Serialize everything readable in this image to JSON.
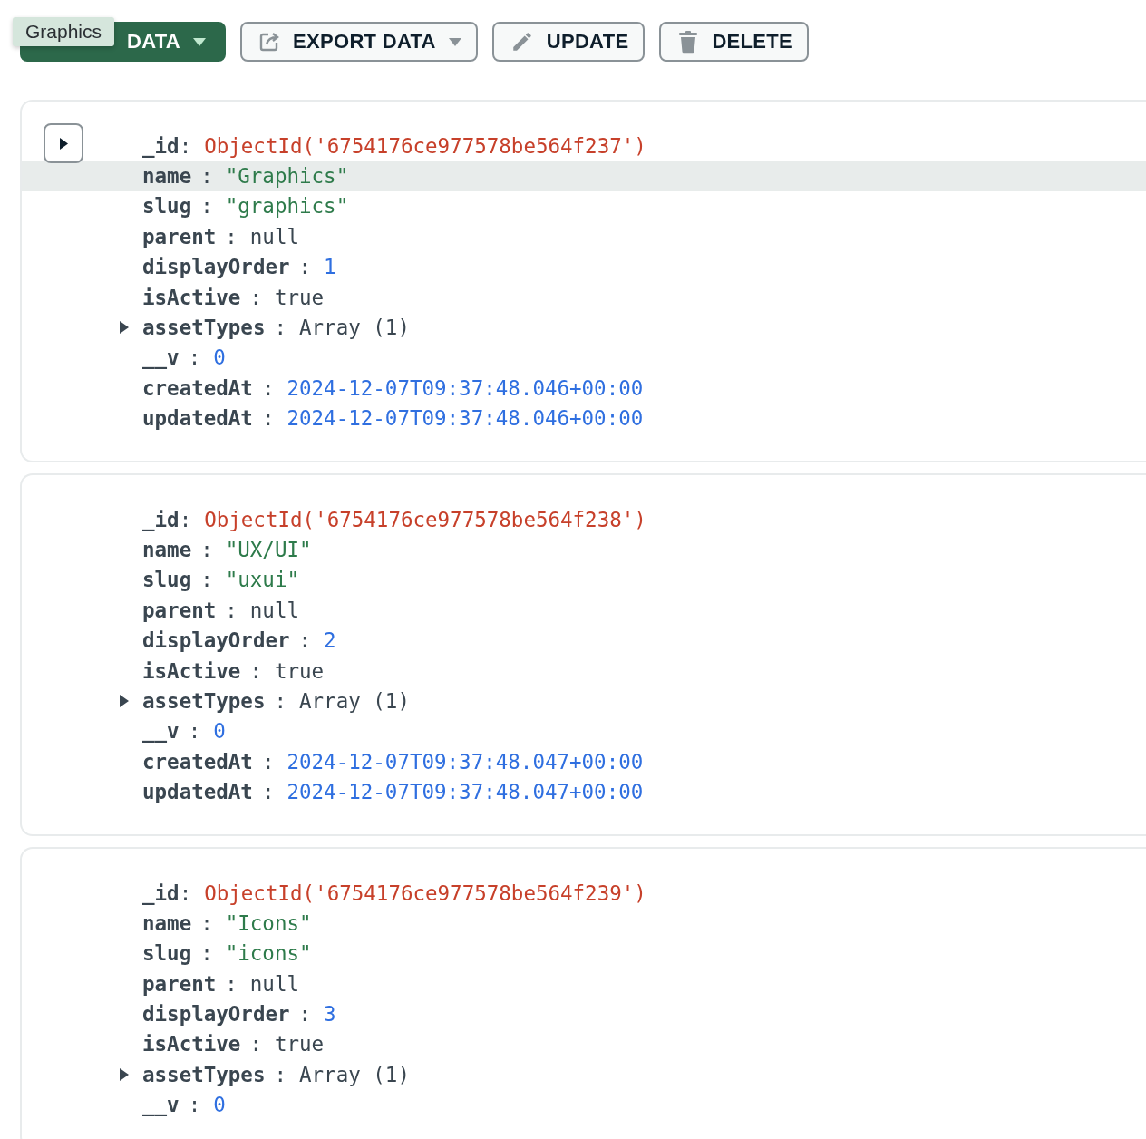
{
  "toolbar": {
    "buttons": [
      {
        "label": "DATA",
        "kind": "primary",
        "dropdown": true
      },
      {
        "label": "EXPORT DATA",
        "kind": "outline",
        "dropdown": true
      },
      {
        "label": "UPDATE",
        "kind": "outline",
        "dropdown": false
      },
      {
        "label": "DELETE",
        "kind": "outline",
        "dropdown": false
      }
    ],
    "tooltip": "Graphics"
  },
  "separator": ":",
  "documents": [
    {
      "hovered": true,
      "fields": [
        {
          "key": "_id",
          "value": "ObjectId('6754176ce977578be564f237')",
          "kind": "objectid",
          "highlighted": false
        },
        {
          "key": "name",
          "value": "\"Graphics\"",
          "kind": "string",
          "highlighted": true
        },
        {
          "key": "slug",
          "value": "\"graphics\"",
          "kind": "string",
          "highlighted": false
        },
        {
          "key": "parent",
          "value": "null",
          "kind": "plain",
          "highlighted": false
        },
        {
          "key": "displayOrder",
          "value": "1",
          "kind": "number",
          "highlighted": false
        },
        {
          "key": "isActive",
          "value": "true",
          "kind": "plain",
          "highlighted": false
        },
        {
          "key": "assetTypes",
          "value": "Array (1)",
          "kind": "array",
          "highlighted": false
        },
        {
          "key": "__v",
          "value": "0",
          "kind": "number",
          "highlighted": false
        },
        {
          "key": "createdAt",
          "value": "2024-12-07T09:37:48.046+00:00",
          "kind": "number",
          "highlighted": false
        },
        {
          "key": "updatedAt",
          "value": "2024-12-07T09:37:48.046+00:00",
          "kind": "number",
          "highlighted": false
        }
      ]
    },
    {
      "hovered": false,
      "fields": [
        {
          "key": "_id",
          "value": "ObjectId('6754176ce977578be564f238')",
          "kind": "objectid",
          "highlighted": false
        },
        {
          "key": "name",
          "value": "\"UX/UI\"",
          "kind": "string",
          "highlighted": false
        },
        {
          "key": "slug",
          "value": "\"uxui\"",
          "kind": "string",
          "highlighted": false
        },
        {
          "key": "parent",
          "value": "null",
          "kind": "plain",
          "highlighted": false
        },
        {
          "key": "displayOrder",
          "value": "2",
          "kind": "number",
          "highlighted": false
        },
        {
          "key": "isActive",
          "value": "true",
          "kind": "plain",
          "highlighted": false
        },
        {
          "key": "assetTypes",
          "value": "Array (1)",
          "kind": "array",
          "highlighted": false
        },
        {
          "key": "__v",
          "value": "0",
          "kind": "number",
          "highlighted": false
        },
        {
          "key": "createdAt",
          "value": "2024-12-07T09:37:48.047+00:00",
          "kind": "number",
          "highlighted": false
        },
        {
          "key": "updatedAt",
          "value": "2024-12-07T09:37:48.047+00:00",
          "kind": "number",
          "highlighted": false
        }
      ]
    },
    {
      "hovered": false,
      "fields": [
        {
          "key": "_id",
          "value": "ObjectId('6754176ce977578be564f239')",
          "kind": "objectid",
          "highlighted": false
        },
        {
          "key": "name",
          "value": "\"Icons\"",
          "kind": "string",
          "highlighted": false
        },
        {
          "key": "slug",
          "value": "\"icons\"",
          "kind": "string",
          "highlighted": false
        },
        {
          "key": "parent",
          "value": "null",
          "kind": "plain",
          "highlighted": false
        },
        {
          "key": "displayOrder",
          "value": "3",
          "kind": "number",
          "highlighted": false
        },
        {
          "key": "isActive",
          "value": "true",
          "kind": "plain",
          "highlighted": false
        },
        {
          "key": "assetTypes",
          "value": "Array (1)",
          "kind": "array",
          "highlighted": false
        },
        {
          "key": "__v",
          "value": "0",
          "kind": "number",
          "highlighted": false
        }
      ]
    }
  ]
}
